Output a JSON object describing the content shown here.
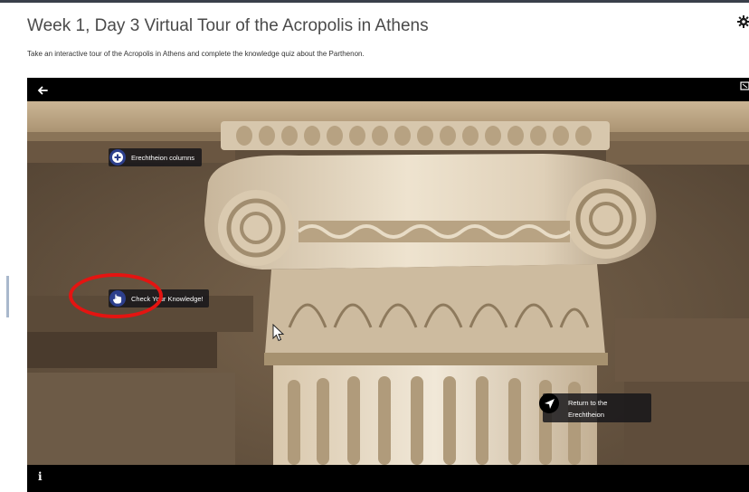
{
  "page": {
    "title": "Week 1, Day 3 Virtual Tour of the Acropolis in Athens",
    "description": "Take an interactive tour of the Acropolis in Athens and complete the knowledge quiz about the Parthenon."
  },
  "tour": {
    "hotspots": {
      "erechtheion_columns": "Erechtheion columns",
      "check_knowledge": "Check Your Knowledge!",
      "return_line1": "Return to the",
      "return_line2": "Erechtheion"
    },
    "icons": {
      "back": "arrow-left-icon",
      "fullscreen": "fullscreen-icon",
      "info": "info-icon",
      "settings": "gear-icon",
      "plus": "plus-circle-icon",
      "hand": "hand-pointer-icon",
      "navigate": "navigation-arrow-icon"
    },
    "colors": {
      "hotspot_accent": "#2d3f8c",
      "annotation": "#e41411"
    }
  }
}
